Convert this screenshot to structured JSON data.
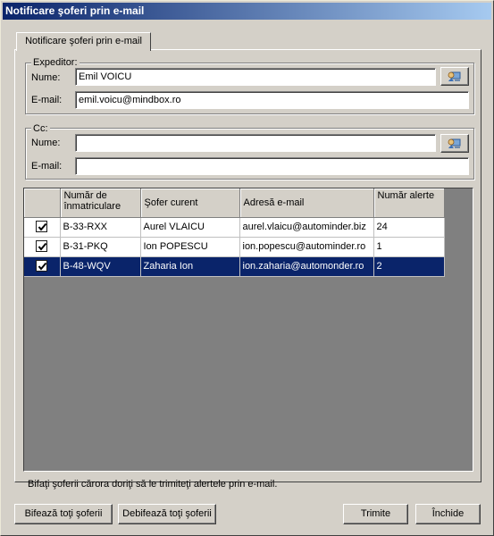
{
  "window": {
    "title": "Notificare şoferi prin e-mail"
  },
  "tab": {
    "label": "Notificare şoferi prin e-mail"
  },
  "sender": {
    "legend": "Expeditor:",
    "name_label": "Nume:",
    "name_value": "Emil VOICU",
    "email_label": "E-mail:",
    "email_value": "emil.voicu@mindbox.ro",
    "address_book_icon": "address-book-icon"
  },
  "cc": {
    "legend": "Cc:",
    "name_label": "Nume:",
    "name_value": "",
    "email_label": "E-mail:",
    "email_value": "",
    "address_book_icon": "address-book-icon"
  },
  "grid": {
    "columns": [
      "",
      "Număr de înmatriculare",
      "Şofer curent",
      "Adresă e-mail",
      "Număr alerte"
    ],
    "rows": [
      {
        "checked": true,
        "plate": "B-33-RXX",
        "driver": "Aurel VLAICU",
        "email": "aurel.vlaicu@autominder.biz",
        "alerts": "24"
      },
      {
        "checked": true,
        "plate": "B-31-PKQ",
        "driver": "Ion POPESCU",
        "email": "ion.popescu@autominder.ro",
        "alerts": "1"
      },
      {
        "checked": true,
        "plate": "B-48-WQV",
        "driver": "Zaharia Ion",
        "email": "ion.zaharia@automonder.ro",
        "alerts": "2",
        "selected": true
      }
    ]
  },
  "hint": "Bifaţi şoferii cărora doriţi să le trimiteţi alertele prin e-mail.",
  "buttons": {
    "check_all": "Bifează toţi şoferii",
    "uncheck_all": "Debifează toţi şoferii",
    "send": "Trimite",
    "close": "Închide"
  },
  "colors": {
    "titlebar_start": "#0a246a",
    "titlebar_end": "#a6caf0",
    "selection": "#0a246a",
    "face": "#d4d0c8"
  }
}
